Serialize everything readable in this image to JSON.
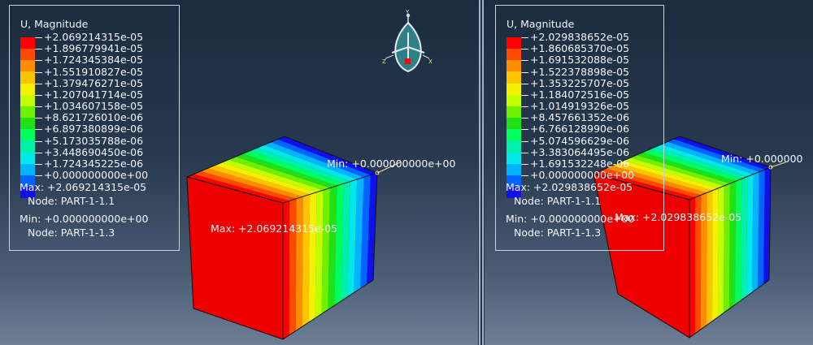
{
  "colors": {
    "bands": [
      "#ff0000",
      "#ff4a00",
      "#ff8c00",
      "#ffc400",
      "#f3f000",
      "#c2ff00",
      "#6ef000",
      "#22e016",
      "#00ff5a",
      "#00f0a8",
      "#00e8e8",
      "#00b4ff",
      "#0064ff",
      "#1010e8"
    ]
  },
  "viewports": [
    {
      "title": "U, Magnitude",
      "values": [
        "+2.069214315e-05",
        "+1.896779941e-05",
        "+1.724345384e-05",
        "+1.551910827e-05",
        "+1.379476271e-05",
        "+1.207041714e-05",
        "+1.034607158e-05",
        "+8.621726010e-06",
        "+6.897380899e-06",
        "+5.173035788e-06",
        "+3.448690450e-06",
        "+1.724345225e-06",
        "+0.000000000e+00"
      ],
      "max_line": "Max: +2.069214315e-05",
      "max_node": "Node: PART-1-1.1",
      "min_line": "Min: +0.000000000e+00",
      "min_node": "Node: PART-1-1.3",
      "min_label": "Min: +0.000000000e+00",
      "max_label": "Max: +2.069214315e-05"
    },
    {
      "title": "U, Magnitude",
      "values": [
        "+2.029838652e-05",
        "+1.860685370e-05",
        "+1.691532088e-05",
        "+1.522378898e-05",
        "+1.353225707e-05",
        "+1.184072516e-05",
        "+1.014919326e-05",
        "+8.457661352e-06",
        "+6.766128990e-06",
        "+5.074596629e-06",
        "+3.383064495e-06",
        "+1.691532248e-06",
        "+0.000000000e+00"
      ],
      "max_line": "Max: +2.029838652e-05",
      "max_node": "Node: PART-1-1.1",
      "min_line": "Min: +0.000000000e+00",
      "min_node": "Node: PART-1-1.3",
      "min_label": "Min: +0.000000",
      "max_label": "Max: +2.029838652e-05"
    }
  ],
  "triad": {
    "y": "Y",
    "z": "Z",
    "x": "X"
  }
}
